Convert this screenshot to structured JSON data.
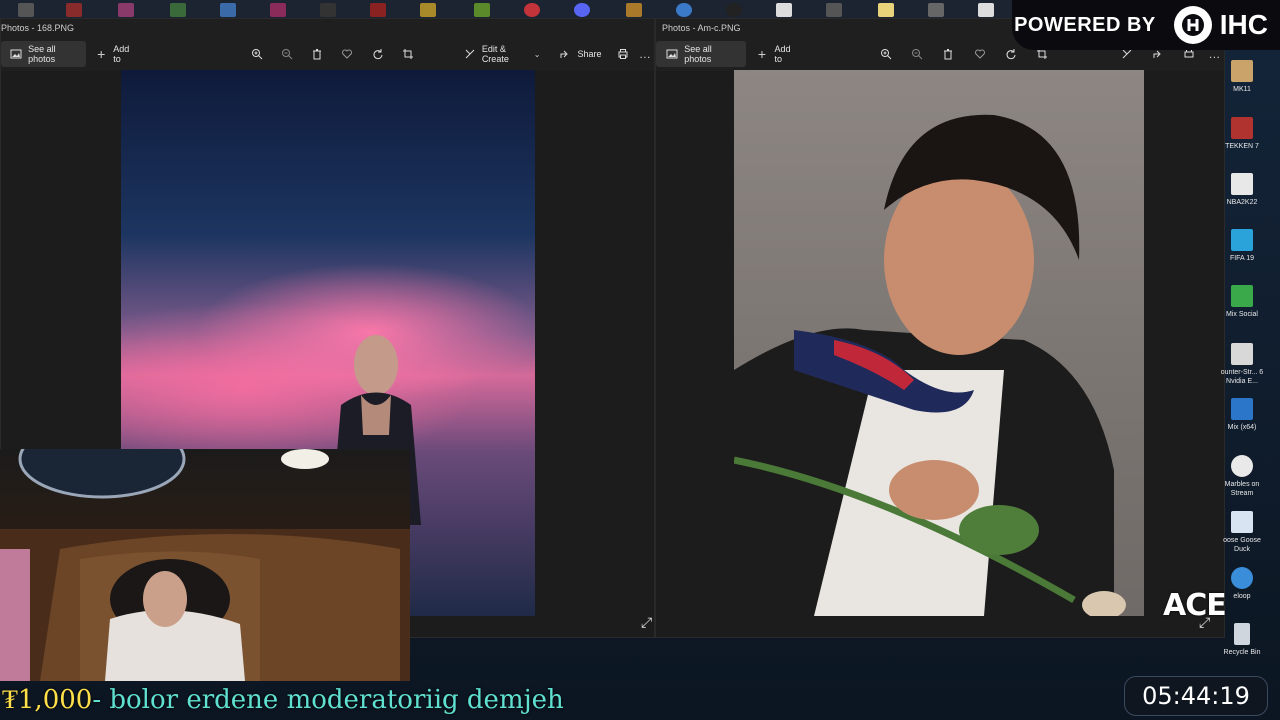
{
  "badge": {
    "powered_by": "POWERED BY",
    "brand": "IHC"
  },
  "left_window": {
    "title": "Photos - 168.PNG",
    "toolbar": {
      "see_all_photos": "See all photos",
      "add_to": "Add to",
      "edit_create": "Edit & Create",
      "share": "Share"
    },
    "icons": [
      "photos-icon",
      "plus-icon",
      "zoom-in-icon",
      "zoom-out-icon",
      "delete-icon",
      "heart-icon",
      "rotate-icon",
      "crop-icon",
      "edit-icon",
      "share-icon",
      "print-icon",
      "more-icon"
    ]
  },
  "right_window": {
    "title": "Photos - Am-c.PNG",
    "toolbar": {
      "see_all_photos": "See all photos",
      "add_to": "Add to"
    }
  },
  "desktop_icons": [
    {
      "label": "MK11",
      "color": "#c9a36a"
    },
    {
      "label": "TEKKEN 7",
      "color": "#b0332f"
    },
    {
      "label": "NBA2K22",
      "color": "#e8e8e8"
    },
    {
      "label": "FIFA 19",
      "color": "#29a3d9"
    },
    {
      "label": "Mix Social",
      "color": "#3aa94a"
    },
    {
      "label": "ounter-Str... 6 Nvidia E...",
      "color": "#d8d8d8"
    },
    {
      "label": "Mix (x64)",
      "color": "#2b76c9"
    },
    {
      "label": "Marbles on Stream",
      "color": "#e9e9e9"
    },
    {
      "label": "oose Goose Duck",
      "color": "#d9e4f2"
    },
    {
      "label": "eloop",
      "color": "#3a8dd8"
    },
    {
      "label": "Recycle Bin",
      "color": "#cfd6de"
    }
  ],
  "ticker": {
    "amount": "₮1,000",
    "message": " - bolor erdene moderatoriig demjeh"
  },
  "clock": "05:44:19",
  "overlay_text": "ACE",
  "colors": {
    "ticker_amount": "#ffe04a",
    "ticker_message": "#5fe0d0"
  }
}
